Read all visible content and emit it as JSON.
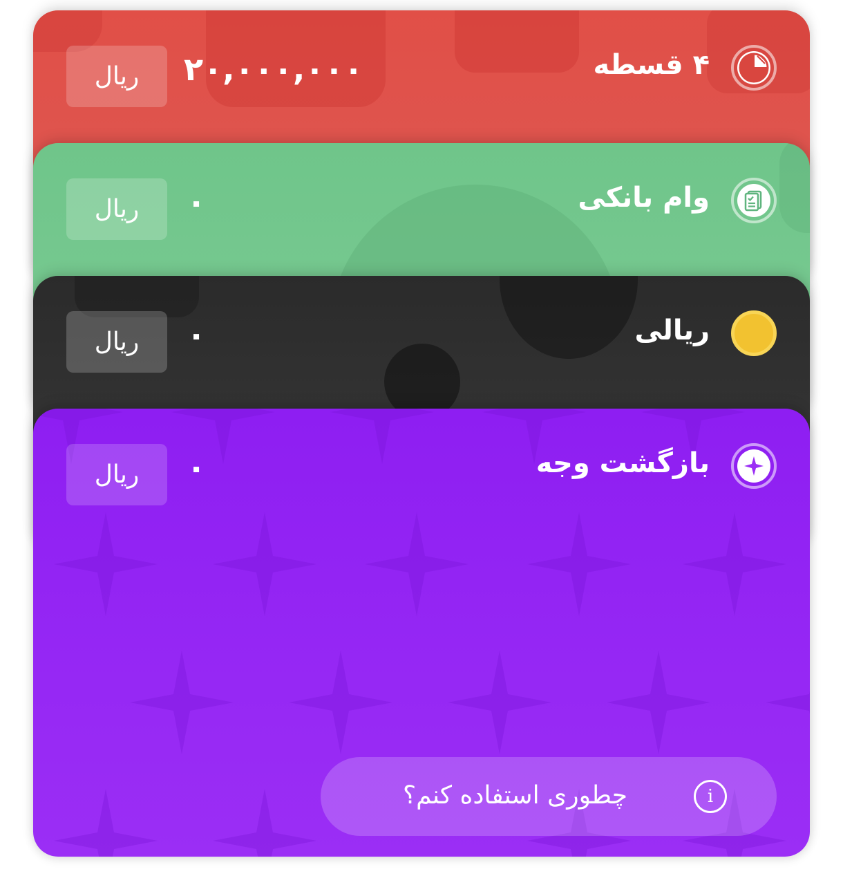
{
  "cards": [
    {
      "id": "installments",
      "title": "۴ قسطه",
      "amount": "۲۰,۰۰۰,۰۰۰",
      "currency": "ریال",
      "icon": "pie-chart-icon",
      "color": "#e14f47"
    },
    {
      "id": "bank-loan",
      "title": "وام بانکی",
      "amount": "۰",
      "currency": "ریال",
      "icon": "document-check-icon",
      "color": "#6fc58a"
    },
    {
      "id": "rial",
      "title": "ریالی",
      "amount": "۰",
      "currency": "ریال",
      "icon": "coin-icon",
      "color": "#2b2b2b"
    },
    {
      "id": "cashback",
      "title": "بازگشت وجه",
      "amount": "۰",
      "currency": "ریال",
      "icon": "sparkle-icon",
      "color": "#8e1ef2"
    }
  ],
  "howto": {
    "label": "چطوری استفاده کنم؟",
    "icon": "info-icon",
    "icon_glyph": "i"
  }
}
